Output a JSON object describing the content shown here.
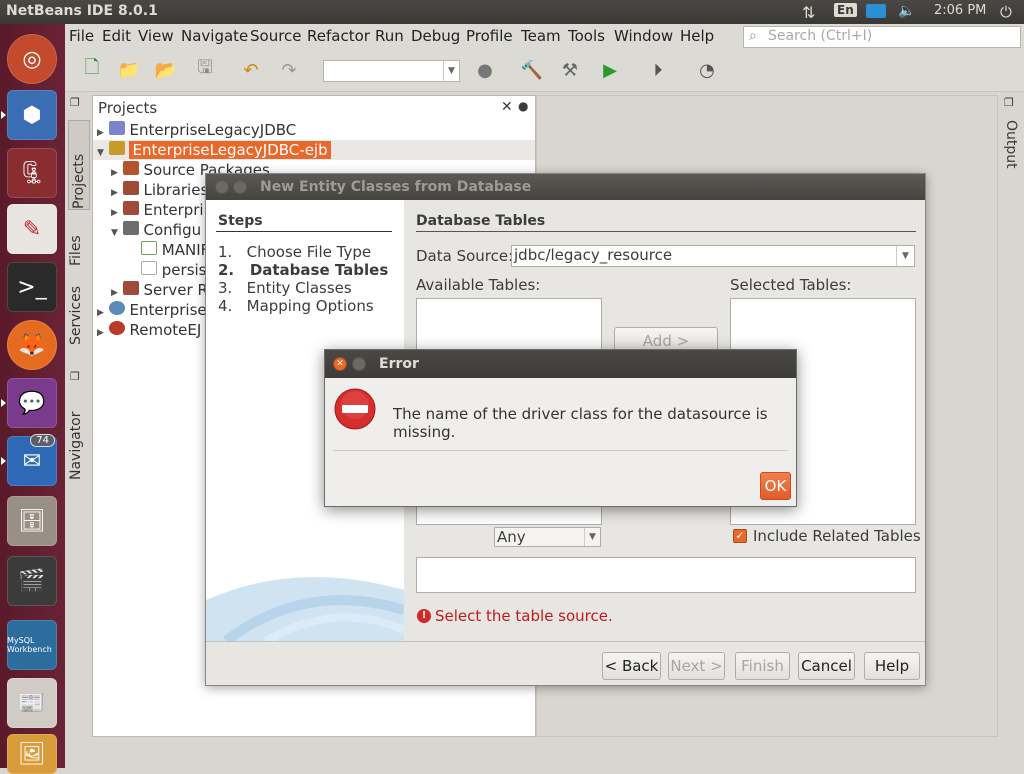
{
  "top_panel": {
    "app_title": "NetBeans IDE 8.0.1",
    "keyboard": "En",
    "time": "2:06 PM"
  },
  "launcher": {
    "thunderbird_badge": "74",
    "workbench_label": "MySQL Workbench"
  },
  "menu": [
    "File",
    "Edit",
    "View",
    "Navigate",
    "Source",
    "Refactor",
    "Run",
    "Debug",
    "Profile",
    "Team",
    "Tools",
    "Window",
    "Help"
  ],
  "search": {
    "placeholder": "Search (Ctrl+I)"
  },
  "sidebar_tabs": {
    "projects": "Projects",
    "files": "Files",
    "services": "Services",
    "navigator": "Navigator",
    "output": "Output"
  },
  "projects": {
    "title": "Projects",
    "items": [
      {
        "label": "EnterpriseLegacyJDBC"
      },
      {
        "label": "EnterpriseLegacyJDBC-ejb"
      },
      {
        "label": "Source Packages"
      },
      {
        "label": "Libraries"
      },
      {
        "label": "Enterpri"
      },
      {
        "label": "Configu"
      },
      {
        "label": "MANIF"
      },
      {
        "label": "persis"
      },
      {
        "label": "Server R"
      },
      {
        "label": "Enterprise"
      },
      {
        "label": "RemoteEJ"
      }
    ]
  },
  "wizard": {
    "title": "New Entity Classes from Database",
    "steps_header": "Steps",
    "steps": [
      {
        "num": "1.",
        "label": "Choose File Type"
      },
      {
        "num": "2.",
        "label": "Database Tables"
      },
      {
        "num": "3.",
        "label": "Entity Classes"
      },
      {
        "num": "4.",
        "label": "Mapping Options"
      }
    ],
    "panel_header": "Database Tables",
    "datasource_label": "Data Source:",
    "datasource_value": "jdbc/legacy_resource",
    "available_label": "Available Tables:",
    "selected_label": "Selected Tables:",
    "add_button": "Add >",
    "filter_value": "Any",
    "include_related": "Include Related Tables",
    "error_message": "Select the table source.",
    "buttons": {
      "back": "< Back",
      "next": "Next >",
      "finish": "Finish",
      "cancel": "Cancel",
      "help": "Help"
    }
  },
  "error_dialog": {
    "title": "Error",
    "message": "The name of the driver class for the datasource is missing.",
    "ok": "OK"
  }
}
